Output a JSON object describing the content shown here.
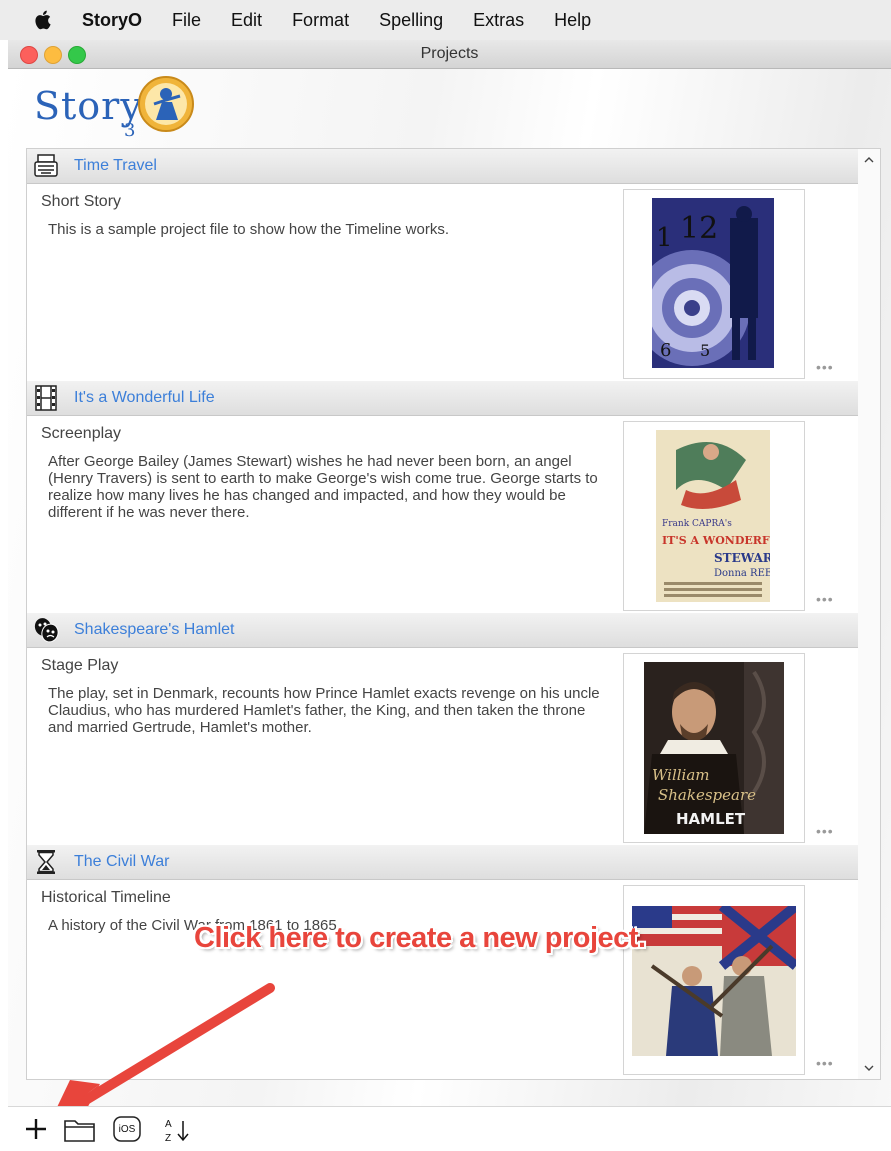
{
  "menubar": {
    "app_name": "StoryO",
    "items": [
      "File",
      "Edit",
      "Format",
      "Spelling",
      "Extras",
      "Help"
    ]
  },
  "window": {
    "title": "Projects"
  },
  "logo": {
    "text": "Story",
    "subscript": "3"
  },
  "projects": [
    {
      "icon": "typewriter-icon",
      "title": "Time Travel",
      "type": "Short Story",
      "description": "This is a sample project file to show how the Timeline works."
    },
    {
      "icon": "film-icon",
      "title": "It's a Wonderful Life",
      "type": "Screenplay",
      "description": "After George Bailey (James Stewart) wishes he had never been born, an angel (Henry Travers) is sent to earth to make George's wish come true. George starts to realize how many lives he has changed and impacted, and how they would be different if he was never there.",
      "poster_text": [
        "IT'S A WONDERFUL LIFE",
        "STEWART",
        "Donna REED",
        "Frank CAPRA's"
      ]
    },
    {
      "icon": "theater-masks-icon",
      "title": "Shakespeare's Hamlet",
      "type": "Stage Play",
      "description": "The play, set in Denmark, recounts how Prince Hamlet exacts revenge on his uncle Claudius, who has murdered Hamlet's father, the King, and then taken the throne and married Gertrude, Hamlet's mother.",
      "cover_text": [
        "William",
        "Shakespeare",
        "HAMLET"
      ]
    },
    {
      "icon": "hourglass-icon",
      "title": "The Civil War",
      "type": "Historical Timeline",
      "description": "A history of the Civil War from 1861 to 1865."
    }
  ],
  "more_label": "•••",
  "annotation": {
    "text": "Click here to create a new project."
  },
  "toolbar": {
    "add_label": "+",
    "ios_label": "iOS",
    "sort_label": "A Z"
  },
  "colors": {
    "link": "#3c7fd9",
    "annotation": "#e8453c",
    "close": "#fc605c",
    "minimize": "#fdbc40",
    "zoom": "#34c84a"
  }
}
